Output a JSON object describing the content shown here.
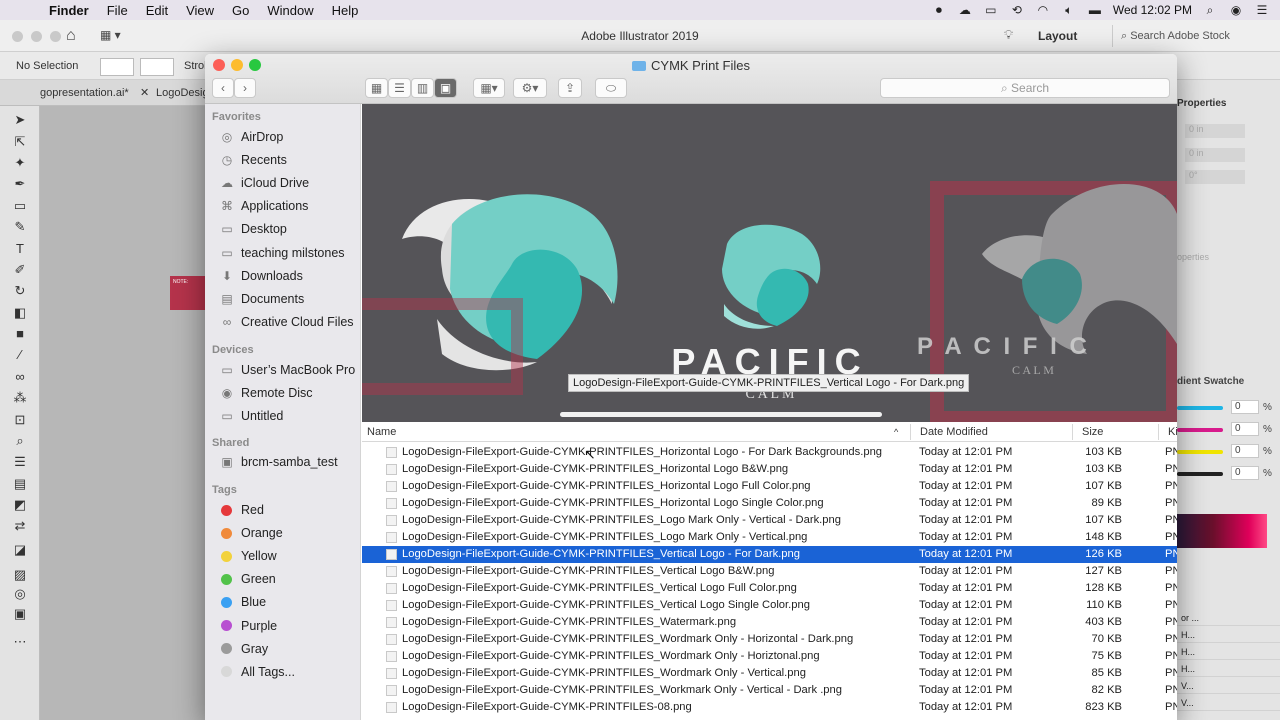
{
  "menubar": {
    "app": "Finder",
    "menus": [
      "File",
      "Edit",
      "View",
      "Go",
      "Window",
      "Help"
    ],
    "clock": "Wed 12:02 PM"
  },
  "illustrator": {
    "title": "Adobe Illustrator 2019",
    "layout": "Layout",
    "stock_placeholder": "Search Adobe Stock",
    "selection": "No Selection",
    "stroke_label": "Strol",
    "tab1": "gopresentation.ai*",
    "tab2": "LogoDesig",
    "note_title": "NOTE:",
    "properties_title": "Properties",
    "properties_rows": [
      "0 in",
      "0 in",
      "0°"
    ],
    "properties_hint": "operties",
    "panel_tabs": "dient  Swatche",
    "color_values": [
      "0",
      "0",
      "0",
      "0"
    ],
    "pct": "%",
    "layer_items": [
      "or ...",
      "H...",
      "H...",
      "H...",
      "V...",
      "V...",
      "V...",
      "V..."
    ]
  },
  "finder": {
    "window_title": "CYMK Print Files",
    "search_placeholder": "Search",
    "sidebar": {
      "favorites_title": "Favorites",
      "favorites": [
        {
          "label": "AirDrop",
          "icon": "airdrop-icon"
        },
        {
          "label": "Recents",
          "icon": "recents-icon"
        },
        {
          "label": "iCloud Drive",
          "icon": "cloud-icon"
        },
        {
          "label": "Applications",
          "icon": "applications-icon"
        },
        {
          "label": "Desktop",
          "icon": "desktop-icon"
        },
        {
          "label": "teaching milstones",
          "icon": "folder-icon"
        },
        {
          "label": "Downloads",
          "icon": "downloads-icon"
        },
        {
          "label": "Documents",
          "icon": "documents-icon"
        },
        {
          "label": "Creative Cloud Files",
          "icon": "creative-cloud-icon"
        }
      ],
      "devices_title": "Devices",
      "devices": [
        {
          "label": "User’s MacBook Pro",
          "icon": "laptop-icon"
        },
        {
          "label": "Remote Disc",
          "icon": "disc-icon"
        },
        {
          "label": "Untitled",
          "icon": "drive-icon"
        }
      ],
      "shared_title": "Shared",
      "shared": [
        {
          "label": "brcm-samba_test",
          "icon": "server-icon"
        }
      ],
      "tags_title": "Tags",
      "tags": [
        {
          "label": "Red",
          "color": "#e5383b"
        },
        {
          "label": "Orange",
          "color": "#f08a3b"
        },
        {
          "label": "Yellow",
          "color": "#f2d23c"
        },
        {
          "label": "Green",
          "color": "#52c24a"
        },
        {
          "label": "Blue",
          "color": "#3aa0f2"
        },
        {
          "label": "Purple",
          "color": "#b84fd1"
        },
        {
          "label": "Gray",
          "color": "#9b9b9b"
        },
        {
          "label": "All Tags...",
          "color": "#d8d8d8"
        }
      ]
    },
    "preview": {
      "wordmark": "PACIFIC",
      "subwordmark": "C A L M",
      "ghost_wordmark": "P A C I F I C",
      "ghost_sub": "C A L M",
      "hover_label": "LogoDesign-FileExport-Guide-CYMK-PRINTFILES_Vertical Logo - For Dark.png"
    },
    "columns": {
      "name": "Name",
      "date": "Date Modified",
      "size": "Size",
      "kind": "Ki"
    },
    "files": [
      {
        "name": "LogoDesign-FileExport-Guide-CYMK-PRINTFILES_Horizontal Logo - For Dark Backgrounds.png",
        "date": "Today at 12:01 PM",
        "size": "103 KB",
        "kind": "PN",
        "selected": false
      },
      {
        "name": "LogoDesign-FileExport-Guide-CYMK-PRINTFILES_Horizontal Logo B&W.png",
        "date": "Today at 12:01 PM",
        "size": "103 KB",
        "kind": "PN",
        "selected": false
      },
      {
        "name": "LogoDesign-FileExport-Guide-CYMK-PRINTFILES_Horizontal Logo Full Color.png",
        "date": "Today at 12:01 PM",
        "size": "107 KB",
        "kind": "PN",
        "selected": false
      },
      {
        "name": "LogoDesign-FileExport-Guide-CYMK-PRINTFILES_Horizontal Logo Single Color.png",
        "date": "Today at 12:01 PM",
        "size": "89 KB",
        "kind": "PN",
        "selected": false
      },
      {
        "name": "LogoDesign-FileExport-Guide-CYMK-PRINTFILES_Logo Mark Only - Vertical - Dark.png",
        "date": "Today at 12:01 PM",
        "size": "107 KB",
        "kind": "PN",
        "selected": false
      },
      {
        "name": "LogoDesign-FileExport-Guide-CYMK-PRINTFILES_Logo Mark Only - Vertical.png",
        "date": "Today at 12:01 PM",
        "size": "148 KB",
        "kind": "PN",
        "selected": false
      },
      {
        "name": "LogoDesign-FileExport-Guide-CYMK-PRINTFILES_Vertical Logo - For Dark.png",
        "date": "Today at 12:01 PM",
        "size": "126 KB",
        "kind": "PN",
        "selected": true
      },
      {
        "name": "LogoDesign-FileExport-Guide-CYMK-PRINTFILES_Vertical Logo B&W.png",
        "date": "Today at 12:01 PM",
        "size": "127 KB",
        "kind": "PN",
        "selected": false
      },
      {
        "name": "LogoDesign-FileExport-Guide-CYMK-PRINTFILES_Vertical Logo Full Color.png",
        "date": "Today at 12:01 PM",
        "size": "128 KB",
        "kind": "PN",
        "selected": false
      },
      {
        "name": "LogoDesign-FileExport-Guide-CYMK-PRINTFILES_Vertical Logo Single Color.png",
        "date": "Today at 12:01 PM",
        "size": "110 KB",
        "kind": "PN",
        "selected": false
      },
      {
        "name": "LogoDesign-FileExport-Guide-CYMK-PRINTFILES_Watermark.png",
        "date": "Today at 12:01 PM",
        "size": "403 KB",
        "kind": "PN",
        "selected": false
      },
      {
        "name": "LogoDesign-FileExport-Guide-CYMK-PRINTFILES_Wordmark Only - Horizontal - Dark.png",
        "date": "Today at 12:01 PM",
        "size": "70 KB",
        "kind": "PN",
        "selected": false
      },
      {
        "name": "LogoDesign-FileExport-Guide-CYMK-PRINTFILES_Wordmark Only - Horiztonal.png",
        "date": "Today at 12:01 PM",
        "size": "75 KB",
        "kind": "PN",
        "selected": false
      },
      {
        "name": "LogoDesign-FileExport-Guide-CYMK-PRINTFILES_Wordmark Only - Vertical.png",
        "date": "Today at 12:01 PM",
        "size": "85 KB",
        "kind": "PN",
        "selected": false
      },
      {
        "name": "LogoDesign-FileExport-Guide-CYMK-PRINTFILES_Workmark Only - Vertical - Dark .png",
        "date": "Today at 12:01 PM",
        "size": "82 KB",
        "kind": "PN",
        "selected": false
      },
      {
        "name": "LogoDesign-FileExport-Guide-CYMK-PRINTFILES-08.png",
        "date": "Today at 12:01 PM",
        "size": "823 KB",
        "kind": "PN",
        "selected": false
      }
    ]
  },
  "colors": {
    "teal": "#34b9b1",
    "teal_light": "#74cfc6",
    "preview_bg": "#555458",
    "selection": "#1a63d6",
    "accent_pink": "#b5334b"
  }
}
